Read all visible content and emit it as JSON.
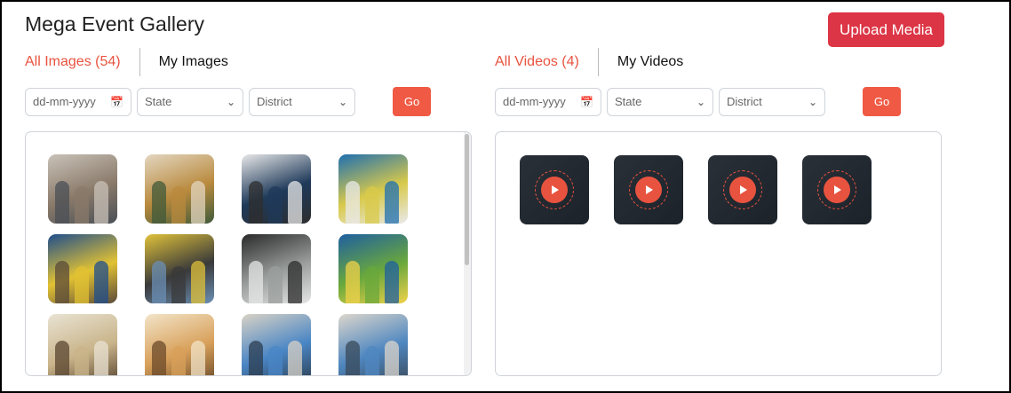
{
  "page": {
    "title": "Mega Event Gallery"
  },
  "upload": {
    "label": "Upload Media"
  },
  "images": {
    "tab_all": "All Images (54)",
    "tab_mine": "My Images",
    "date_placeholder": "dd-mm-yyyy",
    "state_label": "State",
    "district_label": "District",
    "go_label": "Go",
    "thumbnails": [
      {
        "colors": [
          "#8a7a6a",
          "#c9c2b8",
          "#4a4f56"
        ]
      },
      {
        "colors": [
          "#b98a3e",
          "#e3d6c0",
          "#3f5a3a"
        ]
      },
      {
        "colors": [
          "#1f3a5a",
          "#e8e8e8",
          "#2d2d2d"
        ]
      },
      {
        "colors": [
          "#d8c94b",
          "#1e6fb0",
          "#e9e9ea"
        ]
      },
      {
        "colors": [
          "#e2c233",
          "#1f4e8c",
          "#5a4a3a"
        ]
      },
      {
        "colors": [
          "#3a3a3a",
          "#e0c23a",
          "#6b8fb5"
        ]
      },
      {
        "colors": [
          "#9a9e9c",
          "#2a2a2a",
          "#e6e6e6"
        ]
      },
      {
        "colors": [
          "#6aa83c",
          "#1e5fa0",
          "#f0d24a"
        ]
      },
      {
        "colors": [
          "#c9b48a",
          "#e9e3d3",
          "#5a4630"
        ]
      },
      {
        "colors": [
          "#d8a05a",
          "#f2e4c8",
          "#6b4a2a"
        ]
      },
      {
        "colors": [
          "#4a86c5",
          "#d9d2c5",
          "#2c3e50"
        ]
      },
      {
        "colors": [
          "#4f87c0",
          "#dcd6cc",
          "#3a4a5a"
        ]
      }
    ]
  },
  "videos": {
    "tab_all": "All Videos (4)",
    "tab_mine": "My Videos",
    "date_placeholder": "dd-mm-yyyy",
    "state_label": "State",
    "district_label": "District",
    "go_label": "Go",
    "count": 4
  },
  "icons": {
    "calendar": "calendar-icon",
    "chevron": "chevron-down-icon",
    "play": "play-icon"
  },
  "colors": {
    "accent": "#e8533f",
    "upload_button": "#dc3545",
    "go_button": "#f05a44"
  }
}
